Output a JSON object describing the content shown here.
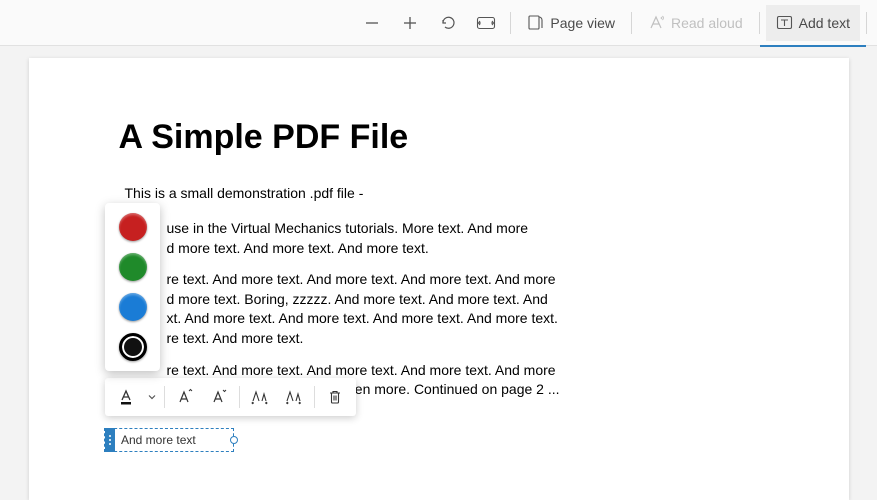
{
  "toolbar": {
    "page_view_label": "Page view",
    "read_aloud_label": "Read aloud",
    "add_text_label": "Add text"
  },
  "document": {
    "title": "A Simple PDF File",
    "intro": "This is a small demonstration .pdf file -",
    "paragraphs": [
      "And more text. And more text. And more text. And more text. And more text. And more text. And more text. And more text. And more text. And more text. And more text. Boring, zzzzz. And more text. And more text. And more text. And more text. And more text. And more text. And more text. And more text. And more text.",
      "use in the Virtual Mechanics tutorials. More text. And more\nd more text. And more text. And more text.",
      "re text. And more text. And more text. And more text. And more\nd more text. Boring, zzzzz. And more text. And more text. And\nxt. And more text. And more text. And more text. And more text.\nre text. And more text.",
      "re text. And more text. And more text. And more text. And more\nd more text. And more text. Even more. Continued on page 2 ..."
    ]
  },
  "color_picker": {
    "colors": [
      {
        "name": "red",
        "hex": "#c62020",
        "selected": false
      },
      {
        "name": "green",
        "hex": "#1f8a2a",
        "selected": false
      },
      {
        "name": "blue",
        "hex": "#1a7cd6",
        "selected": false
      },
      {
        "name": "black",
        "hex": "#111111",
        "selected": true
      }
    ]
  },
  "annotation": {
    "text": "And more text"
  }
}
